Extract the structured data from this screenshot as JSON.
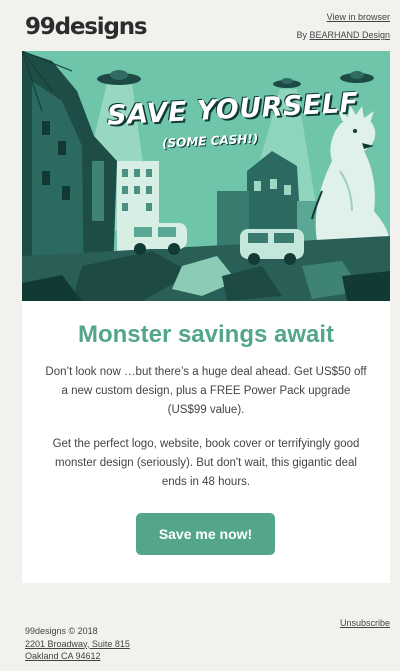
{
  "header": {
    "logo": "99designs",
    "view_in_browser": "View in browser",
    "by_prefix": "By",
    "by_link": "BEARHAND Design"
  },
  "hero": {
    "title": "SAVE YOURSELF",
    "subtitle": "(SOME CASH!)"
  },
  "card": {
    "headline": "Monster savings await",
    "paragraph1": "Don’t look now …but there’s a huge deal ahead. Get US$50 off a new custom design, plus a FREE Power Pack upgrade (US$99 value).",
    "paragraph2": "Get the perfect logo, website, book cover or terrifyingly good monster design (seriously). But don't wait, this gigantic deal ends in 48 hours.",
    "cta_label": "Save me now!"
  },
  "footer": {
    "copyright": "99designs © 2018",
    "address_line1": "2201 Broadway, Suite 815",
    "address_line2": "Oakland CA 94612",
    "unsubscribe": "Unsubscribe"
  },
  "colors": {
    "accent": "#53a58b",
    "background": "#f2f1ee",
    "hero_mint": "#6fc5a9",
    "hero_dark": "#0f3a35"
  }
}
